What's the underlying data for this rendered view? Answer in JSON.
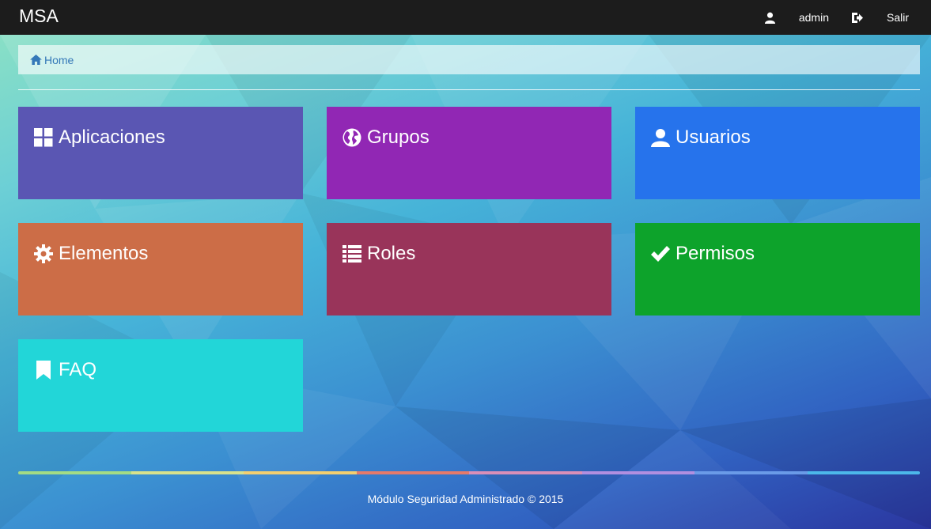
{
  "navbar": {
    "brand": "MSA",
    "user_label": "admin",
    "logout_label": "Salir"
  },
  "breadcrumb": {
    "home_label": "Home"
  },
  "tiles": [
    {
      "label": "Aplicaciones",
      "icon": "th-large-icon",
      "color": "#5a56b3"
    },
    {
      "label": "Grupos",
      "icon": "globe-icon",
      "color": "#9127b4"
    },
    {
      "label": "Usuarios",
      "icon": "user-icon",
      "color": "#2673ec"
    },
    {
      "label": "Elementos",
      "icon": "cog-icon",
      "color": "#cc6d47"
    },
    {
      "label": "Roles",
      "icon": "list-icon",
      "color": "#99345a"
    },
    {
      "label": "Permisos",
      "icon": "check-icon",
      "color": "#0da32b"
    },
    {
      "label": "FAQ",
      "icon": "bookmark-icon",
      "color": "#22d6d8"
    }
  ],
  "footer": {
    "text": "Módulo Seguridad Administrado © 2015",
    "stripe_colors": [
      "#a4dc84",
      "#d8e28c",
      "#f3cf70",
      "#e57a6b",
      "#d98fb8",
      "#b18fe0",
      "#6a9be8",
      "#4cb8ea"
    ]
  }
}
